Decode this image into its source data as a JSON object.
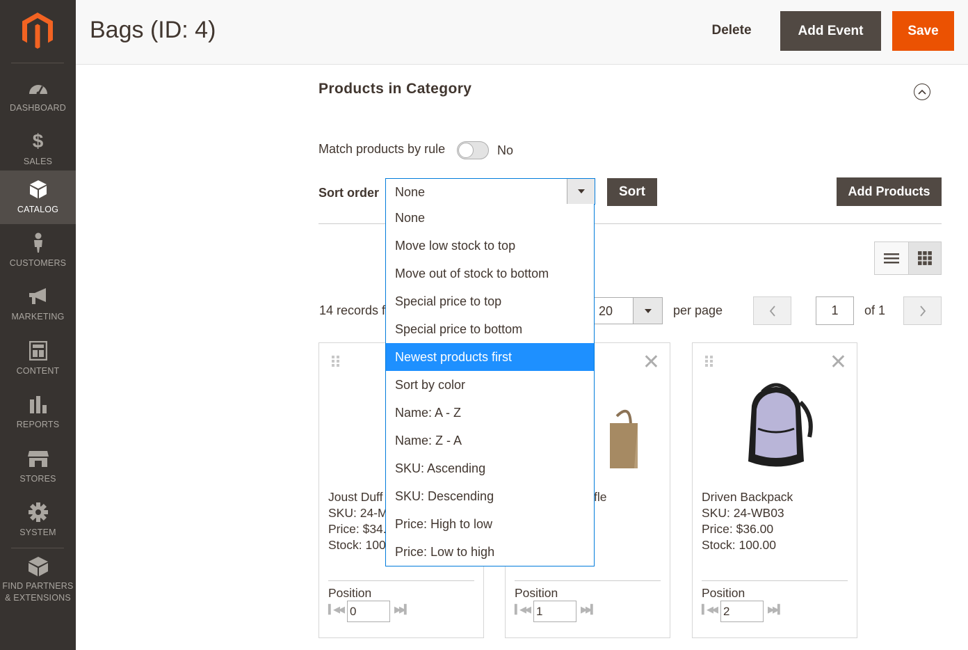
{
  "sidebar": {
    "items": [
      {
        "label": "DASHBOARD",
        "icon": "dashboard-icon"
      },
      {
        "label": "SALES",
        "icon": "dollar-icon"
      },
      {
        "label": "CATALOG",
        "icon": "box-icon"
      },
      {
        "label": "CUSTOMERS",
        "icon": "person-icon"
      },
      {
        "label": "MARKETING",
        "icon": "megaphone-icon"
      },
      {
        "label": "CONTENT",
        "icon": "layout-icon"
      },
      {
        "label": "REPORTS",
        "icon": "bar-chart-icon"
      },
      {
        "label": "STORES",
        "icon": "store-icon"
      },
      {
        "label": "SYSTEM",
        "icon": "gear-icon"
      }
    ],
    "partners_line1": "FIND PARTNERS",
    "partners_line2": "& EXTENSIONS"
  },
  "header": {
    "title": "Bags (ID: 4)",
    "delete_label": "Delete",
    "add_event_label": "Add Event",
    "save_label": "Save"
  },
  "section": {
    "title": "Products in Category",
    "match_label": "Match products by rule",
    "match_value": "No",
    "sort_label": "Sort order",
    "sort_value": "None",
    "sort_button": "Sort",
    "add_products_button": "Add Products"
  },
  "dropdown": {
    "options": [
      "None",
      "Move low stock to top",
      "Move out of stock to bottom",
      "Special price to top",
      "Special price to bottom",
      "Newest products first",
      "Sort by color",
      "Name: A - Z",
      "Name: Z - A",
      "SKU: Ascending",
      "SKU: Descending",
      "Price: High to low",
      "Price: Low to high"
    ],
    "highlighted": "Newest products first"
  },
  "grid": {
    "records_text": "14 records f",
    "per_page_value": "20",
    "per_page_label": "per page",
    "page_value": "1",
    "page_of": "of 1"
  },
  "products": [
    {
      "name": "Joust Duff",
      "sku": "SKU: 24-M",
      "price": "Price: $34.",
      "stock": "Stock: 100",
      "position_label": "Position",
      "position": "0"
    },
    {
      "name": "fle",
      "sku": "",
      "price": "",
      "stock": "",
      "position_label": "Position",
      "position": "1"
    },
    {
      "name": "Driven Backpack",
      "sku": "SKU: 24-WB03",
      "price": "Price: $36.00",
      "stock": "Stock: 100.00",
      "position_label": "Position",
      "position": "2"
    }
  ],
  "colors": {
    "sidebar_bg": "#373330",
    "primary_button": "#514943",
    "save_button": "#eb5202",
    "highlight": "#1e90ff",
    "focus_border": "#007bdb"
  }
}
